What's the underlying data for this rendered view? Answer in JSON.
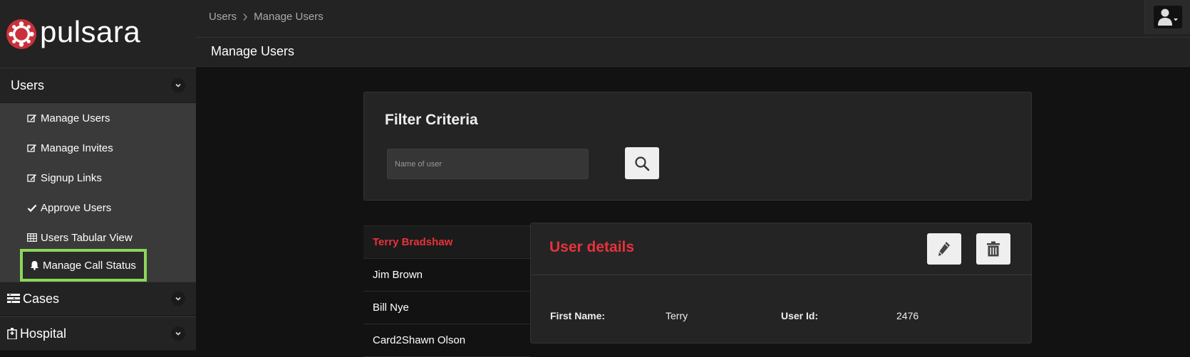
{
  "brand": {
    "name": "pulsara",
    "accent": "#c8313b"
  },
  "sidebar": {
    "sections": [
      {
        "label": "Users",
        "icon": "users-icon"
      },
      {
        "label": "Cases",
        "icon": "cases-icon"
      },
      {
        "label": "Hospital",
        "icon": "hospital-icon"
      }
    ],
    "users_items": [
      {
        "label": "Manage Users",
        "icon": "edit-icon"
      },
      {
        "label": "Manage Invites",
        "icon": "edit-icon"
      },
      {
        "label": "Signup Links",
        "icon": "edit-icon"
      },
      {
        "label": "Approve Users",
        "icon": "check-icon"
      },
      {
        "label": "Users Tabular View",
        "icon": "table-icon"
      },
      {
        "label": "Manage Call Status",
        "icon": "bell-icon"
      }
    ],
    "highlight_color": "#8cd65a"
  },
  "topbar": {
    "breadcrumb": [
      "Users",
      "Manage Users"
    ]
  },
  "page": {
    "title": "Manage Users"
  },
  "filter": {
    "title": "Filter Criteria",
    "search_placeholder": "Name of user"
  },
  "users": [
    "Terry Bradshaw",
    "Jim Brown",
    "Bill Nye",
    "Card2Shawn Olson"
  ],
  "details": {
    "title": "User details",
    "fields": [
      {
        "label": "First Name:",
        "value": "Terry"
      },
      {
        "label": "User Id:",
        "value": "2476"
      }
    ]
  }
}
